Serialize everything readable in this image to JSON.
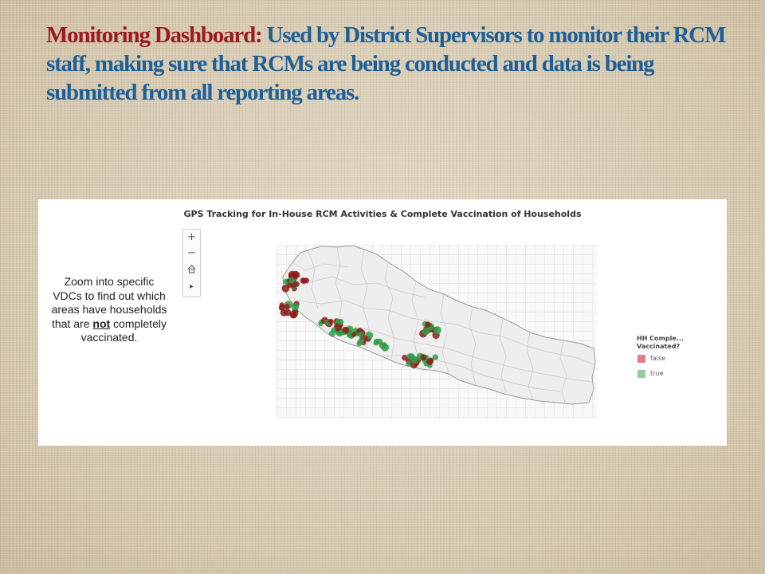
{
  "slide": {
    "title_lead": "Monitoring Dashboard:",
    "title_rest": " Used by District Supervisors to monitor their RCM staff, making sure that RCMs are being conducted and data is being submitted from all reporting areas.",
    "lead_color": "#9c1a1f",
    "text_color": "#1d5f96"
  },
  "dashboard": {
    "title": "GPS Tracking for In-House RCM Activities & Complete Vaccination of Households",
    "zoom_controls": [
      {
        "name": "zoom-in",
        "glyph": "+"
      },
      {
        "name": "zoom-out",
        "glyph": "−"
      },
      {
        "name": "home",
        "glyph": "⌂"
      },
      {
        "name": "toolbar-expand",
        "glyph": "▸"
      }
    ],
    "note": {
      "before": "Zoom into specific VDCs to find out which areas have households that are ",
      "emphasis": "not",
      "after": " completely vaccinated."
    },
    "legend": {
      "title_line1": "HH Comple...",
      "title_line2": "Vaccinated?",
      "items": [
        {
          "label": "false",
          "color": "#e07b8b"
        },
        {
          "label": "true",
          "color": "#8fcf9e"
        }
      ]
    },
    "map": {
      "region": "Nepal districts",
      "point_colors": {
        "false": "#8e1b1b",
        "true": "#2e9e46"
      }
    }
  }
}
